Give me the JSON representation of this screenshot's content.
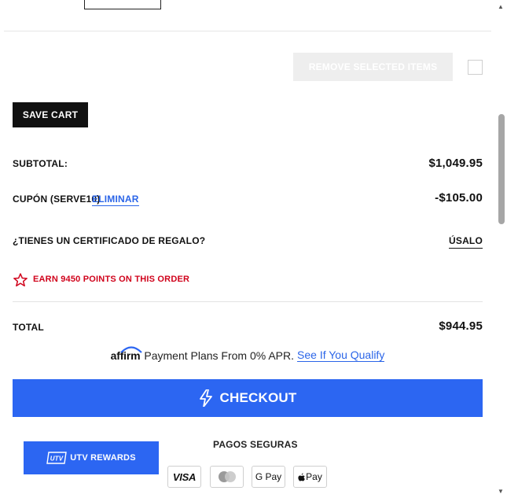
{
  "cart_actions": {
    "remove_selected_label": "Remove selected items",
    "save_cart_label": "SAVE CART"
  },
  "summary": {
    "subtotal_label": "SUBTOTAL:",
    "subtotal_value": "$1,049.95",
    "coupon_label": "CUPÓN (SERVE10)",
    "coupon_remove_label": "ELIMINAR",
    "coupon_value": "-$105.00",
    "gift_label": "¿TIENES UN CERTIFICADO DE REGALO?",
    "gift_link": "ÚSALO",
    "points_text": "EARN 9450 POINTS ON THIS ORDER",
    "total_label": "TOTAL",
    "total_value": "$944.95"
  },
  "affirm": {
    "logo_text": "affirm",
    "text": "Payment Plans From 0% APR.",
    "link": "See If You Qualify"
  },
  "checkout": {
    "label": "CHECKOUT",
    "icon": "lightning-bolt-icon"
  },
  "rewards": {
    "label": "UTV REWARDS",
    "logo_text": "UTV"
  },
  "payments": {
    "label": "PAGOS SEGURAS",
    "methods": [
      "VISA",
      "Mastercard",
      "G Pay",
      "Apple Pay"
    ],
    "gpay_text": "G Pay",
    "applepay_text": "Pay",
    "visa_text": "VISA"
  },
  "colors": {
    "accent": "#2c66f2",
    "link": "#2b65e8",
    "points_red": "#d0021b",
    "dark_button": "#111111"
  }
}
